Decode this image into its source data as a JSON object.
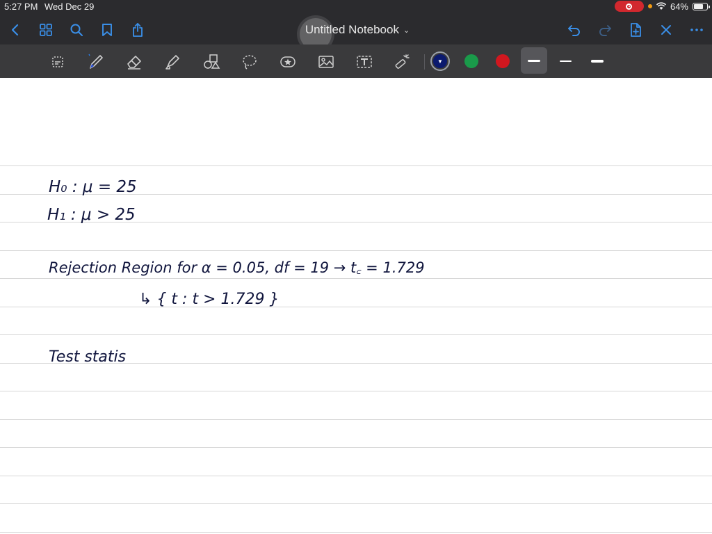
{
  "status": {
    "time": "5:27 PM",
    "date": "Wed Dec 29",
    "battery_text": "64%",
    "battery_level": 0.64
  },
  "navbar": {
    "title": "Untitled Notebook",
    "icons": [
      "back-icon",
      "grid-icon",
      "search-icon",
      "bookmark-icon",
      "share-icon",
      "undo-icon",
      "redo-icon",
      "add-page-icon",
      "close-icon",
      "more-icon"
    ]
  },
  "toolbar": {
    "tools": [
      "lasso-select-icon",
      "pen-icon",
      "eraser-icon",
      "highlighter-icon",
      "shapes-icon",
      "lasso-icon",
      "sticker-icon",
      "image-icon",
      "text-icon",
      "laser-pointer-icon"
    ],
    "colors": [
      "#0b1a6e",
      "#1a9a4a",
      "#d1171f"
    ],
    "selected_color": "#0b1a6e"
  },
  "notes": {
    "line1": "H₀ : μ = 25",
    "line2": "H₁ : μ > 25",
    "line3": "Rejection Region for α = 0.05, df = 19 → t꜀ = 1.729",
    "line4": "↳ { t : t > 1.729 }",
    "line5": "Test statis"
  }
}
